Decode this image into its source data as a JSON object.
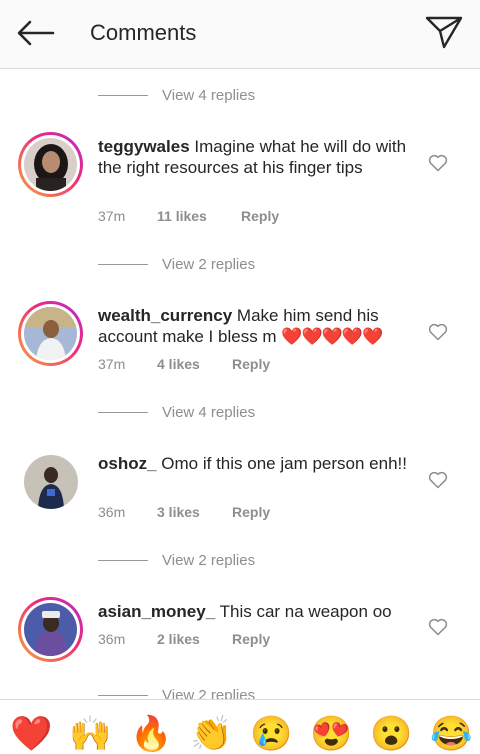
{
  "header": {
    "title": "Comments"
  },
  "icons": {
    "back": "arrow-left-icon",
    "send": "paper-plane-icon",
    "like": "heart-outline-icon"
  },
  "reply_threads": [
    {
      "label": "View 4 replies"
    },
    {
      "label": "View 2 replies"
    },
    {
      "label": "View 4 replies"
    },
    {
      "label": "View 2 replies"
    },
    {
      "label": "View 2 replies"
    }
  ],
  "comments": [
    {
      "username": "teggywales",
      "text": "Imagine what he will do with the right resources at his finger tips",
      "time": "37m",
      "likes": "11 likes",
      "reply": "Reply"
    },
    {
      "username": "wealth_currency",
      "text": "Make him send his account make I bless m",
      "hearts": "❤️❤️❤️❤️❤️",
      "time": "37m",
      "likes": "4 likes",
      "reply": "Reply"
    },
    {
      "username": "oshoz_",
      "text": "Omo if this one jam person enh!!",
      "time": "36m",
      "likes": "3 likes",
      "reply": "Reply"
    },
    {
      "username": "asian_money_",
      "text": "This car na weapon oo",
      "time": "36m",
      "likes": "2 likes",
      "reply": "Reply"
    }
  ],
  "emoji_bar": [
    "❤️",
    "🙌",
    "🔥",
    "👏",
    "😢",
    "😍",
    "😮",
    "😂"
  ],
  "colors": {
    "ring_start": "#f9a33a",
    "ring_end": "#b42bd0",
    "heart_red": "#d6161b",
    "muted": "#8e8e8e"
  }
}
